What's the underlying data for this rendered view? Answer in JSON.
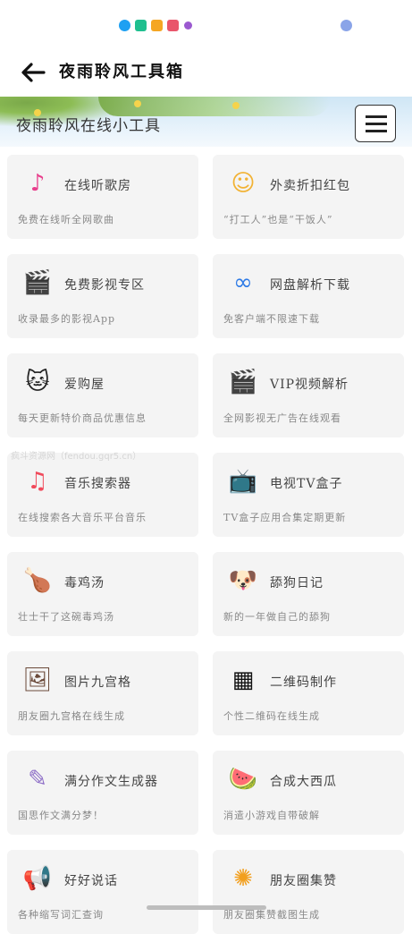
{
  "header": {
    "title": "夜雨聆风工具箱"
  },
  "banner": {
    "title": "夜雨聆风在线小工具"
  },
  "watermark": "疯斗资源网（fendou.gqr5.cn）",
  "tools": [
    {
      "title": "在线听歌房",
      "desc": "免费在线听全网歌曲",
      "icon": "music-note-icon",
      "glyph": "♪",
      "color": "#e83e8c"
    },
    {
      "title": "外卖折扣红包",
      "desc": "“打工人”也是“干饭人”",
      "icon": "meme-face-icon",
      "glyph": "☺",
      "color": "#f2b233"
    },
    {
      "title": "免费影视专区",
      "desc": "收录最多的影视App",
      "icon": "clapperboard-icon",
      "glyph": "🎬",
      "color": "#222222"
    },
    {
      "title": "网盘解析下载",
      "desc": "免客户端不限速下载",
      "icon": "cloud-disk-icon",
      "glyph": "∞",
      "color": "#2f7be6"
    },
    {
      "title": "爱购屋",
      "desc": "每天更新特价商品优惠信息",
      "icon": "shopping-cat-icon",
      "glyph": "🐱",
      "color": "#222222"
    },
    {
      "title": "VIP视频解析",
      "desc": "全网影视无广告在线观看",
      "icon": "clapperboard-icon",
      "glyph": "🎬",
      "color": "#222222"
    },
    {
      "title": "音乐搜索器",
      "desc": "在线搜索各大音乐平台音乐",
      "icon": "music-app-icon",
      "glyph": "♫",
      "color": "#f04a5b"
    },
    {
      "title": "电视TV盒子",
      "desc": "TV盒子应用合集定期更新",
      "icon": "tv-icon",
      "glyph": "📺",
      "color": "#a0522d"
    },
    {
      "title": "毒鸡汤",
      "desc": "壮士干了这碗毒鸡汤",
      "icon": "roast-chicken-icon",
      "glyph": "🍗",
      "color": "#d2691e"
    },
    {
      "title": "舔狗日记",
      "desc": "新的一年做自己的舔狗",
      "icon": "doge-icon",
      "glyph": "🐶",
      "color": "#e8a33d"
    },
    {
      "title": "图片九宫格",
      "desc": "朋友圈九宫格在线生成",
      "icon": "portrait-icon",
      "glyph": "🖼",
      "color": "#6b4a3a"
    },
    {
      "title": "二维码制作",
      "desc": "个性二维码在线生成",
      "icon": "qr-code-icon",
      "glyph": "▦",
      "color": "#111111"
    },
    {
      "title": "满分作文生成器",
      "desc": "国思作文满分梦！",
      "icon": "writing-icon",
      "glyph": "✎",
      "color": "#8e6fc7"
    },
    {
      "title": "合成大西瓜",
      "desc": "消遣小游戏自带破解",
      "icon": "watermelon-icon",
      "glyph": "🍉",
      "color": "#2e8b3e"
    },
    {
      "title": "好好说话",
      "desc": "各种缩写词汇查询",
      "icon": "megaphone-icon",
      "glyph": "📢",
      "color": "#d94b3b"
    },
    {
      "title": "朋友圈集赞",
      "desc": "朋友圈集赞截图生成",
      "icon": "aperture-icon",
      "glyph": "✺",
      "color": "#f29f1e"
    }
  ]
}
